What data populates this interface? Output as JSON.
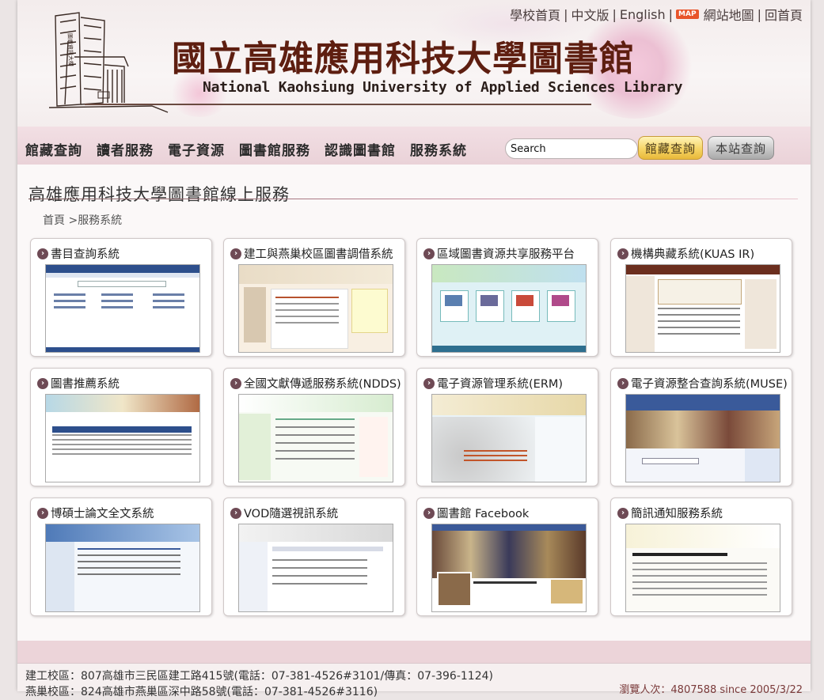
{
  "top_links": [
    "學校首頁",
    "中文版",
    "English",
    "網站地圖",
    "回首頁"
  ],
  "map_badge": "MAP",
  "title_zh": "國立高雄應用科技大學圖書館",
  "title_en": "National Kaohsiung University of Applied Sciences Library",
  "nav": [
    "館藏查詢",
    "讀者服務",
    "電子資源",
    "圖書館服務",
    "認識圖書館",
    "服務系統"
  ],
  "search": {
    "placeholder": "Search",
    "value": "Search",
    "collection_button": "館藏查詢",
    "site_button": "本站查詢"
  },
  "page_title": "高雄應用科技大學圖書館線上服務",
  "breadcrumb": {
    "home": "首頁",
    "separator": ">",
    "current": "服務系統"
  },
  "cards": [
    "書目查詢系統",
    "建工與燕巢校區圖書調借系統",
    "區域圖書資源共享服務平台",
    "機構典藏系統(KUAS IR)",
    "圖書推薦系統",
    "全國文獻傳遞服務系統(NDDS)",
    "電子資源管理系統(ERM)",
    "電子資源整合查詢系統(MUSE)",
    "博碩士論文全文系統",
    "VOD隨選視訊系統",
    "圖書館 Facebook",
    "簡訊通知服務系統"
  ],
  "footer": {
    "address_1": "建工校區：807高雄市三民區建工路415號(電話：07-381-4526#3101/傳真：07-396-1124)",
    "address_2": "燕巢校區：824高雄市燕巢區深中路58號(電話：07-381-4526#3116)",
    "counter": "瀏覽人次：4807588 since 2005/3/22"
  },
  "colors": {
    "title_brown": "#5e1e10",
    "nav_band": "#ead2d8",
    "gold_button": "#f6d465",
    "gray_button": "#c8c8c8",
    "chevron": "#6e4a55"
  }
}
